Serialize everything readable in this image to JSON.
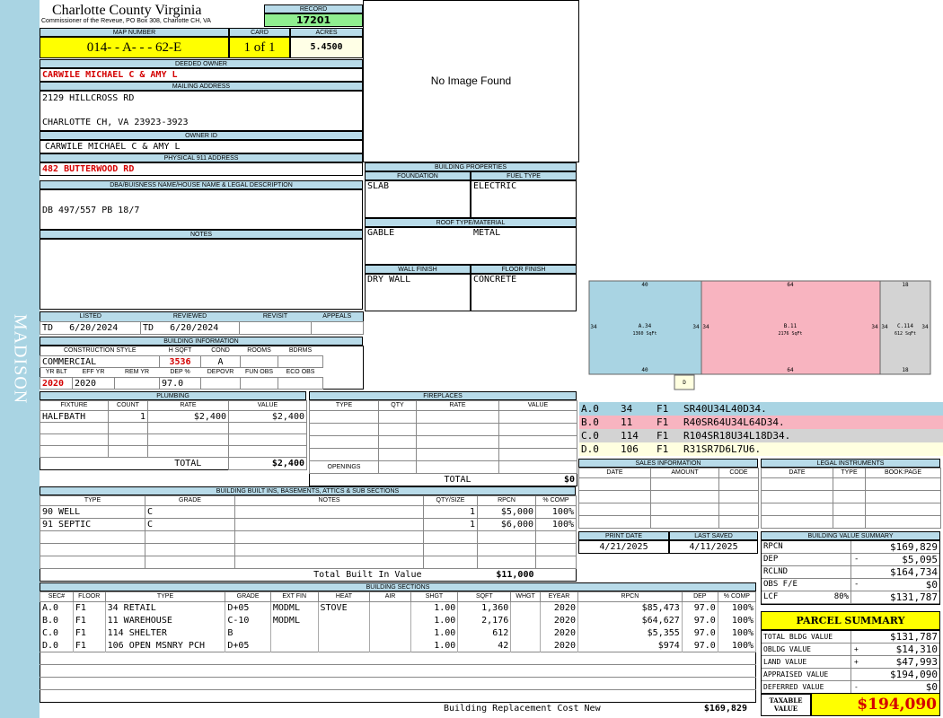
{
  "sidebar": {
    "district": "MADISON"
  },
  "header": {
    "county": "Charlotte County Virginia",
    "office": "Commissioner of the Reveue, PO Box 308, Charlotte CH, VA",
    "record_label": "RECORD",
    "record": "17201"
  },
  "parcel": {
    "map_label": "MAP NUMBER",
    "map_number": "014- - A- - - 62-E",
    "card_label": "CARD",
    "card": "1 of 1",
    "acres_label": "ACRES",
    "acres": "5.4500"
  },
  "owner": {
    "deeded_label": "DEEDED OWNER",
    "deeded": "CARWILE MICHAEL C & AMY L",
    "mailing_label": "MAILING ADDRESS",
    "mailing1": "2129 HILLCROSS RD",
    "mailing2": "CHARLOTTE CH, VA 23923-3923",
    "owner_id_label": "OWNER ID",
    "owner_id": "CARWILE MICHAEL C & AMY L",
    "phys_label": "PHYSICAL 911 ADDRESS",
    "phys": "482 BUTTERWOOD RD"
  },
  "legal": {
    "label": "DBA/BUISNESS NAME/HOUSE NAME & LEGAL DESCRIPTION",
    "text": "DB 497/557 PB 18/7"
  },
  "notes": {
    "label": "NOTES",
    "text": ""
  },
  "image": {
    "text": "No Image Found"
  },
  "review": {
    "listed_label": "LISTED",
    "reviewed_label": "REVIEWED",
    "revisit_label": "REVISIT",
    "appeals_label": "APPEALS",
    "listed_by": "TD",
    "listed_date": "6/20/2024",
    "reviewed_by": "TD",
    "reviewed_date": "6/20/2024"
  },
  "building_info": {
    "label": "BUILDING INFORMATION",
    "cs_label": "CONSTRUCTION STYLE",
    "hsqft_label": "H SQFT",
    "cond_label": "COND",
    "rooms_label": "ROOMS",
    "bdrms_label": "BDRMS",
    "style": "COMMERCIAL",
    "hsqft": "3536",
    "cond": "A",
    "yrblt_label": "YR BLT",
    "effyr_label": "EFF YR",
    "remyr_label": "REM YR",
    "dep_label": "DEP %",
    "depovr_label": "DEPOVR",
    "funobs_label": "FUN OBS",
    "ecoobs_label": "ECO OBS",
    "yrblt": "2020",
    "effyr": "2020",
    "dep": "97.0"
  },
  "bprops": {
    "label": "BUILDING PROPERTIES",
    "foundation_label": "FOUNDATION",
    "fuel_label": "FUEL TYPE",
    "foundation": "SLAB",
    "fuel": "ELECTRIC",
    "roof_label": "ROOF TYPE/MATERIAL",
    "roof_type": "GABLE",
    "roof_mat": "METAL",
    "wall_label": "WALL FINISH",
    "floor_label": "FLOOR FINISH",
    "wall": "DRY WALL",
    "floor": "CONCRETE"
  },
  "sketch": {
    "blocks": [
      {
        "id": "A.34",
        "sqft": "1360 SqFt",
        "top": "40",
        "bottom": "40",
        "left": "34",
        "right": "34",
        "color": "#a9d4e3"
      },
      {
        "id": "B.11",
        "sqft": "2176 SqFt",
        "top": "64",
        "bottom": "64",
        "left": "34",
        "right": "34",
        "color": "#f8b4c0"
      },
      {
        "id": "C.114",
        "sqft": "612 SqFt",
        "top": "18",
        "bottom": "18",
        "left": "34",
        "right": "34",
        "color": "#d3d3d3"
      }
    ],
    "d_label": "D"
  },
  "sketch_codes": [
    {
      "sec": "A.0",
      "num": "34",
      "floor": "F1",
      "code": "SR40U34L40D34.",
      "color": "#a9d4e3"
    },
    {
      "sec": "B.0",
      "num": "11",
      "floor": "F1",
      "code": "R40SR64U34L64D34.",
      "color": "#f8b4c0"
    },
    {
      "sec": "C.0",
      "num": "114",
      "floor": "F1",
      "code": "R104SR18U34L18D34.",
      "color": "#d3d3d3"
    },
    {
      "sec": "D.0",
      "num": "106",
      "floor": "F1",
      "code": "R31SR7D6L7U6.",
      "color": "#ffffe0"
    }
  ],
  "plumbing": {
    "label": "PLUMBING",
    "headers": [
      "FIXTURE",
      "COUNT",
      "RATE",
      "VALUE"
    ],
    "rows": [
      [
        "HALFBATH",
        "1",
        "$2,400",
        "$2,400"
      ],
      [
        "",
        "",
        "",
        ""
      ],
      [
        "",
        "",
        "",
        ""
      ],
      [
        "",
        "",
        "",
        ""
      ]
    ],
    "total_label": "TOTAL",
    "total": "$2,400"
  },
  "fireplaces": {
    "label": "FIREPLACES",
    "headers": [
      "TYPE",
      "QTY",
      "RATE",
      "VALUE"
    ],
    "openings_label": "OPENINGS",
    "total_label": "TOTAL",
    "total": "$0"
  },
  "sales": {
    "label": "SALES INFORMATION",
    "headers": [
      "DATE",
      "AMOUNT",
      "CODE"
    ]
  },
  "legal_inst": {
    "label": "LEGAL INSTRUMENTS",
    "headers": [
      "DATE",
      "TYPE",
      "BOOK:PAGE"
    ]
  },
  "builtins": {
    "label": "BUILDING BUILT INS, BASEMENTS, ATTICS & SUB SECTIONS",
    "headers": [
      "TYPE",
      "GRADE",
      "NOTES",
      "QTY/SIZE",
      "RPCN",
      "% COMP"
    ],
    "rows": [
      [
        "90 WELL",
        "C",
        "",
        "1",
        "$5,000",
        "100%"
      ],
      [
        "91 SEPTIC",
        "C",
        "",
        "1",
        "$6,000",
        "100%"
      ]
    ],
    "total_label": "Total Built In Value",
    "total": "$11,000"
  },
  "dates": {
    "print_label": "PRINT DATE",
    "saved_label": "LAST SAVED",
    "print": "4/21/2025",
    "saved": "4/11/2025"
  },
  "bvs": {
    "label": "BUILDING VALUE SUMMARY",
    "rows": [
      {
        "k": "RPCN",
        "s": "",
        "pct": "",
        "v": "$169,829"
      },
      {
        "k": "DEP",
        "s": "-",
        "pct": "",
        "v": "$5,095"
      },
      {
        "k": "RCLND",
        "s": "",
        "pct": "",
        "v": "$164,734"
      },
      {
        "k": "OBS F/E",
        "s": "-",
        "pct": "",
        "v": "$0"
      },
      {
        "k": "LCF",
        "s": "",
        "pct": "80%",
        "v": "$131,787"
      }
    ]
  },
  "summary": {
    "label": "PARCEL SUMMARY",
    "rows": [
      {
        "k": "TOTAL BLDG VALUE",
        "s": "",
        "v": "$131,787"
      },
      {
        "k": "OBLDG VALUE",
        "s": "+",
        "v": "$14,310"
      },
      {
        "k": "LAND VALUE",
        "s": "+",
        "v": "$47,993"
      },
      {
        "k": "APPRAISED VALUE",
        "s": "",
        "v": "$194,090"
      },
      {
        "k": "DEFERRED VALUE",
        "s": "-",
        "v": "$0"
      }
    ],
    "taxable_label": "TAXABLE VALUE",
    "taxable": "$194,090"
  },
  "sections": {
    "label": "BUILDING SECTIONS",
    "headers": [
      "SEC#",
      "FLOOR",
      "TYPE",
      "GRADE",
      "EXT FIN",
      "HEAT",
      "AIR",
      "SHGT",
      "SQFT",
      "WHGT",
      "EYEAR",
      "RPCN",
      "DEP",
      "% COMP"
    ],
    "rows": [
      [
        "A.0",
        "F1",
        "34 RETAIL",
        "D+05",
        "MODML",
        "STOVE",
        "",
        "1.00",
        "1,360",
        "",
        "2020",
        "$85,473",
        "97.0",
        "100%"
      ],
      [
        "B.0",
        "F1",
        "11 WAREHOUSE",
        "C-10",
        "MODML",
        "",
        "",
        "1.00",
        "2,176",
        "",
        "2020",
        "$64,627",
        "97.0",
        "100%"
      ],
      [
        "C.0",
        "F1",
        "114 SHELTER",
        "B",
        "",
        "",
        "",
        "1.00",
        "612",
        "",
        "2020",
        "$5,355",
        "97.0",
        "100%"
      ],
      [
        "D.0",
        "F1",
        "106 OPEN MSNRY PCH",
        "D+05",
        "",
        "",
        "",
        "1.00",
        "42",
        "",
        "2020",
        "$974",
        "97.0",
        "100%"
      ]
    ],
    "brcn_label": "Building Replacement Cost New",
    "brcn": "$169,829"
  }
}
